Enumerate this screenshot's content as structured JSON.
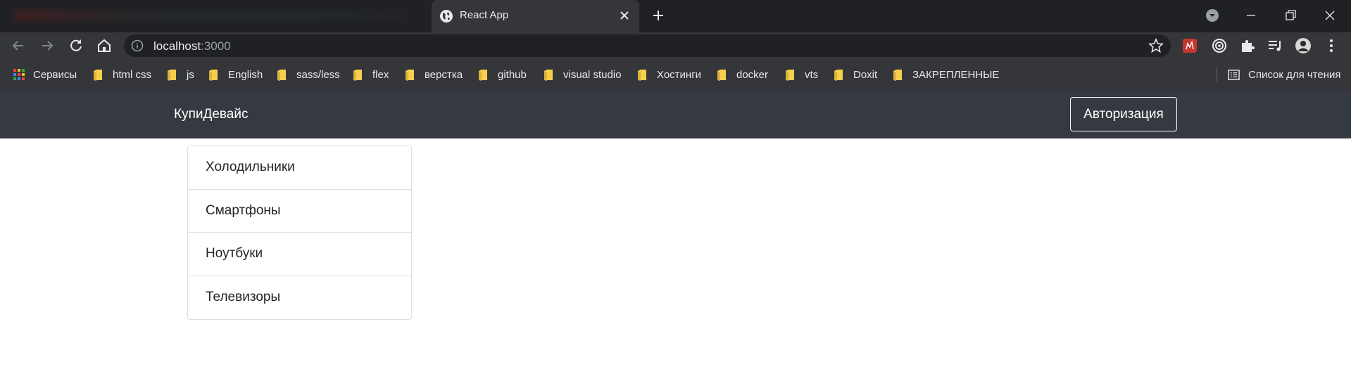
{
  "browser": {
    "tab": {
      "title": "React App",
      "favicon": "globe-icon"
    },
    "omnibox": {
      "host": "localhost",
      "port": ":3000"
    },
    "bookmarks": [
      {
        "label": "Сервисы",
        "icon": "apps-grid-icon"
      },
      {
        "label": "html css",
        "icon": "folder-icon"
      },
      {
        "label": "js",
        "icon": "folder-icon"
      },
      {
        "label": "English",
        "icon": "folder-icon"
      },
      {
        "label": "sass/less",
        "icon": "folder-icon"
      },
      {
        "label": "flex",
        "icon": "folder-icon"
      },
      {
        "label": "верстка",
        "icon": "folder-icon"
      },
      {
        "label": "github",
        "icon": "folder-icon"
      },
      {
        "label": "visual studio",
        "icon": "folder-icon"
      },
      {
        "label": "Хостинги",
        "icon": "folder-icon"
      },
      {
        "label": "docker",
        "icon": "folder-icon"
      },
      {
        "label": "vts",
        "icon": "folder-icon"
      },
      {
        "label": "Doxit",
        "icon": "folder-icon"
      },
      {
        "label": "ЗАКРЕПЛЕННЫЕ",
        "icon": "folder-icon"
      }
    ],
    "reading_list": {
      "label": "Список для чтения",
      "icon": "reading-list-icon"
    }
  },
  "app": {
    "brand": "КупиДевайс",
    "auth_button": "Авторизация",
    "categories": [
      "Холодильники",
      "Смартфоны",
      "Ноутбуки",
      "Телевизоры"
    ]
  },
  "colors": {
    "browser_frame": "#202124",
    "browser_toolbar": "#35363a",
    "navbar": "#343a40",
    "folder": "#f6d04d",
    "list_border": "#dfdfdf"
  }
}
